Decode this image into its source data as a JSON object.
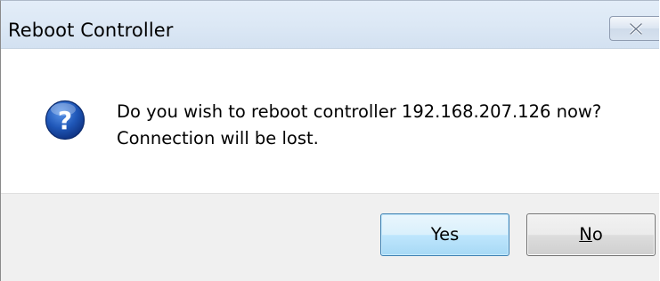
{
  "window": {
    "title": "Reboot Controller",
    "close_icon": "close-x-icon"
  },
  "message": {
    "icon": "question-icon",
    "line1": "Do you wish to reboot controller 192.168.207.126 now?",
    "line2": "Connection will be lost."
  },
  "buttons": {
    "yes_label": "Yes",
    "no_accel": "N",
    "no_rest": "o"
  },
  "colors": {
    "titlebar": "#dce8f5",
    "footer": "#f0f0f0",
    "default_button_border": "#3c7fb1",
    "question_icon_blue": "#1f57b8"
  }
}
